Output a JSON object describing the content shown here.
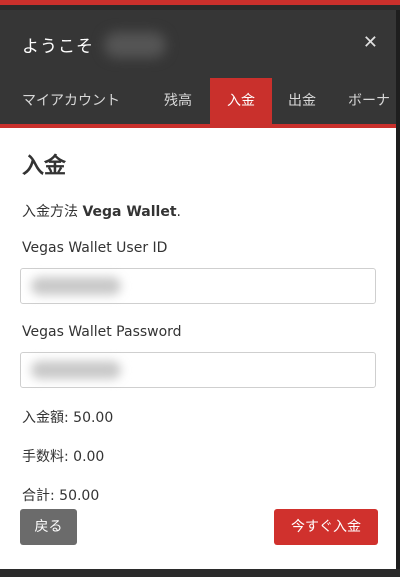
{
  "header": {
    "title": "ようこそ",
    "close_icon": "close-icon"
  },
  "tabs": [
    {
      "label": "マイアカウント"
    },
    {
      "label": "残高"
    },
    {
      "label": "入金",
      "active": true
    },
    {
      "label": "出金"
    },
    {
      "label": "ボーナ"
    }
  ],
  "content": {
    "title": "入金",
    "method_prefix": "入金方法 ",
    "method_name": "Vega Wallet",
    "method_suffix": ".",
    "user_id_label": "Vegas Wallet User ID",
    "password_label": "Vegas Wallet Password",
    "amount": "入金額: 50.00",
    "fee": "手数料: 0.00",
    "total": "合計: 50.00"
  },
  "buttons": {
    "back": "戻る",
    "deposit_now": "今すぐ入金"
  },
  "colors": {
    "accent": "#c9302c",
    "header_bg": "#363636",
    "back_button": "#6b6b6b"
  }
}
